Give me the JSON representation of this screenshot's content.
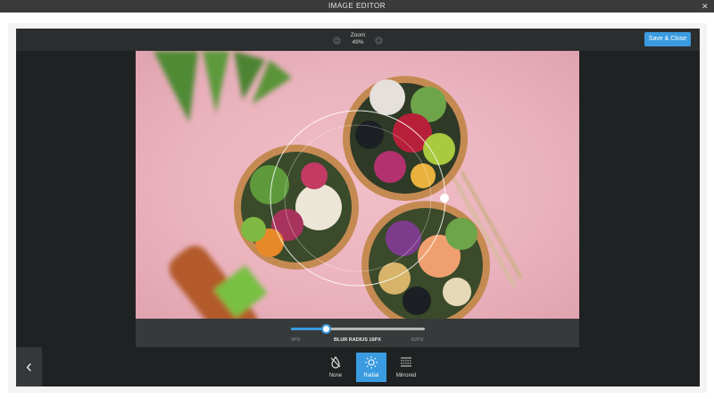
{
  "window": {
    "title": "IMAGE EDITOR",
    "close_glyph": "✕"
  },
  "topbar": {
    "zoom_label": "Zoom",
    "zoom_value": "49%",
    "zoom_minus_glyph": "−",
    "zoom_plus_glyph": "+",
    "save_label": "Save & Close"
  },
  "slider": {
    "min_label": "0PX",
    "max_label": "62PX",
    "label": "BLUR RADIUS 16PX",
    "value_fraction": 0.26
  },
  "modes": [
    {
      "label": "None",
      "icon": "drop-slash-icon",
      "active": false
    },
    {
      "label": "Radial",
      "icon": "sun-radial-icon",
      "active": true
    },
    {
      "label": "Mirrored",
      "icon": "mirrored-lines-icon",
      "active": false
    }
  ],
  "back_glyph": "‹",
  "colors": {
    "accent": "#3a9be0",
    "editor_bg": "#1f2223",
    "photo_pink": "#eab2bd"
  }
}
